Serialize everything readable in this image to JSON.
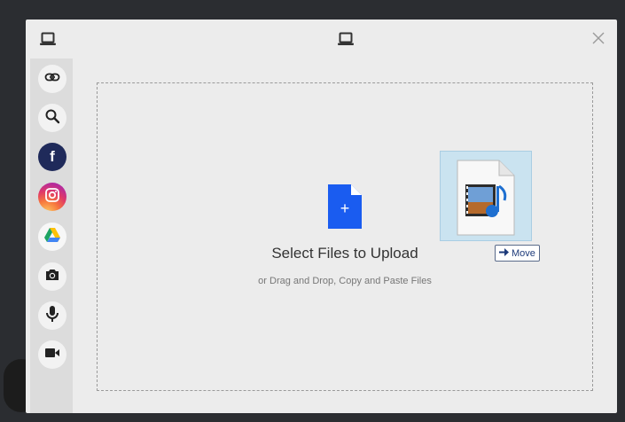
{
  "modal": {
    "header": {
      "left_icon": "laptop-icon",
      "center_icon": "laptop-icon",
      "close_icon": "close-icon"
    },
    "sidebar": {
      "items": [
        {
          "name": "link",
          "icon": "link-icon"
        },
        {
          "name": "search",
          "icon": "search-icon"
        },
        {
          "name": "facebook",
          "icon": "facebook-icon",
          "glyph": "f",
          "color": "#1f2a5a"
        },
        {
          "name": "instagram",
          "icon": "instagram-icon"
        },
        {
          "name": "google-drive",
          "icon": "google-drive-icon"
        },
        {
          "name": "camera",
          "icon": "camera-icon"
        },
        {
          "name": "microphone",
          "icon": "microphone-icon"
        },
        {
          "name": "video",
          "icon": "video-icon"
        }
      ]
    },
    "dropzone": {
      "plus_glyph": "+",
      "title": "Select Files to Upload",
      "subtitle": "or Drag and Drop, Copy and Paste Files",
      "accent_color": "#1a5cf0"
    },
    "drag_feedback": {
      "file_icon": "media-file-icon",
      "move_label": "Move",
      "arrow_icon": "arrow-right-icon"
    }
  }
}
